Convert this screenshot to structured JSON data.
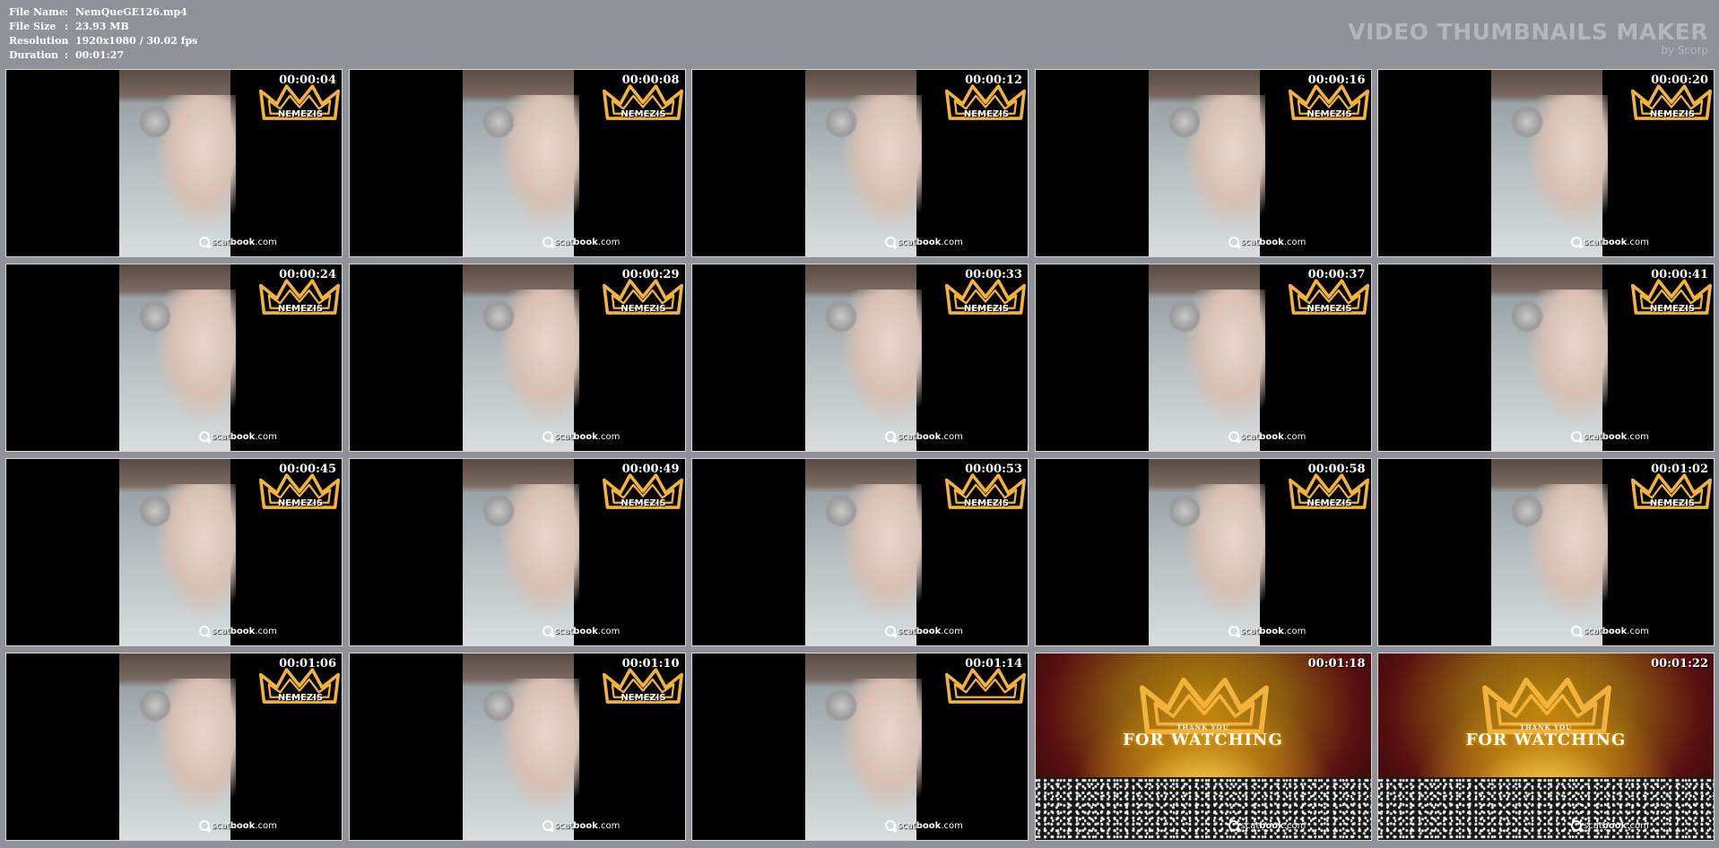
{
  "info": {
    "rows": [
      {
        "label": "File Name",
        "sep": ":",
        "value": "NemQueGE126.mp4"
      },
      {
        "label": "File Size",
        "sep": ":",
        "value": "23.93 MB"
      },
      {
        "label": "Resolution",
        "sep": ":",
        "value": "1920x1080 / 30.02 fps"
      },
      {
        "label": "Duration",
        "sep": ":",
        "value": "00:01:27"
      }
    ]
  },
  "brand": {
    "title": "VIDEO THUMBNAILS MAKER",
    "subtitle": "by Scorp"
  },
  "watermark": {
    "prefix": "scat",
    "bold": "book",
    "suffix": ".com"
  },
  "crown_label": "NEMEZIS",
  "end_text": {
    "small": "THANK YOU",
    "big": "FOR WATCHING"
  },
  "colors": {
    "gold": "#f2b33c",
    "background": "#8f9399"
  },
  "thumbnails": [
    {
      "time": "00:00:04",
      "type": "scene"
    },
    {
      "time": "00:00:08",
      "type": "scene"
    },
    {
      "time": "00:00:12",
      "type": "scene"
    },
    {
      "time": "00:00:16",
      "type": "scene"
    },
    {
      "time": "00:00:20",
      "type": "scene"
    },
    {
      "time": "00:00:24",
      "type": "scene"
    },
    {
      "time": "00:00:29",
      "type": "scene"
    },
    {
      "time": "00:00:33",
      "type": "scene"
    },
    {
      "time": "00:00:37",
      "type": "scene"
    },
    {
      "time": "00:00:41",
      "type": "scene"
    },
    {
      "time": "00:00:45",
      "type": "scene"
    },
    {
      "time": "00:00:49",
      "type": "scene"
    },
    {
      "time": "00:00:53",
      "type": "scene"
    },
    {
      "time": "00:00:58",
      "type": "scene"
    },
    {
      "time": "00:01:02",
      "type": "scene"
    },
    {
      "time": "00:01:06",
      "type": "scene"
    },
    {
      "time": "00:01:10",
      "type": "scene"
    },
    {
      "time": "00:01:14",
      "type": "scene-nolabel"
    },
    {
      "time": "00:01:18",
      "type": "end"
    },
    {
      "time": "00:01:22",
      "type": "end"
    }
  ]
}
